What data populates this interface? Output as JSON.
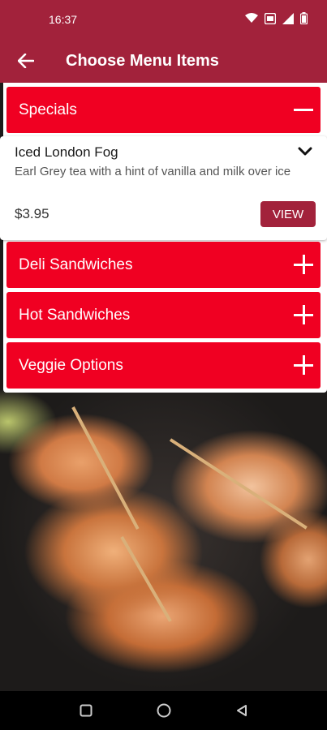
{
  "status_bar": {
    "time": "16:37",
    "icons": [
      "wifi-icon",
      "nfc-icon",
      "signal-icon",
      "battery-icon"
    ]
  },
  "app_bar": {
    "back_icon": "arrow-left-icon",
    "title": "Choose Menu Items"
  },
  "categories": [
    {
      "label": "Specials",
      "expanded": true,
      "toggle_icon": "minus-icon"
    },
    {
      "label": "Deli Sandwiches",
      "expanded": false,
      "toggle_icon": "plus-icon"
    },
    {
      "label": "Hot Sandwiches",
      "expanded": false,
      "toggle_icon": "plus-icon"
    },
    {
      "label": "Veggie Options",
      "expanded": false,
      "toggle_icon": "plus-icon"
    }
  ],
  "items": [
    {
      "name": "Iced London Fog",
      "description": "Earl Grey tea with a hint of vanilla and milk over ice",
      "price": "$3.95",
      "view_label": "VIEW"
    }
  ],
  "nav_bar": {
    "buttons": [
      "recents-square-icon",
      "home-circle-icon",
      "back-triangle-icon"
    ]
  },
  "colors": {
    "primary": "#a2223b",
    "category": "#f00022"
  }
}
